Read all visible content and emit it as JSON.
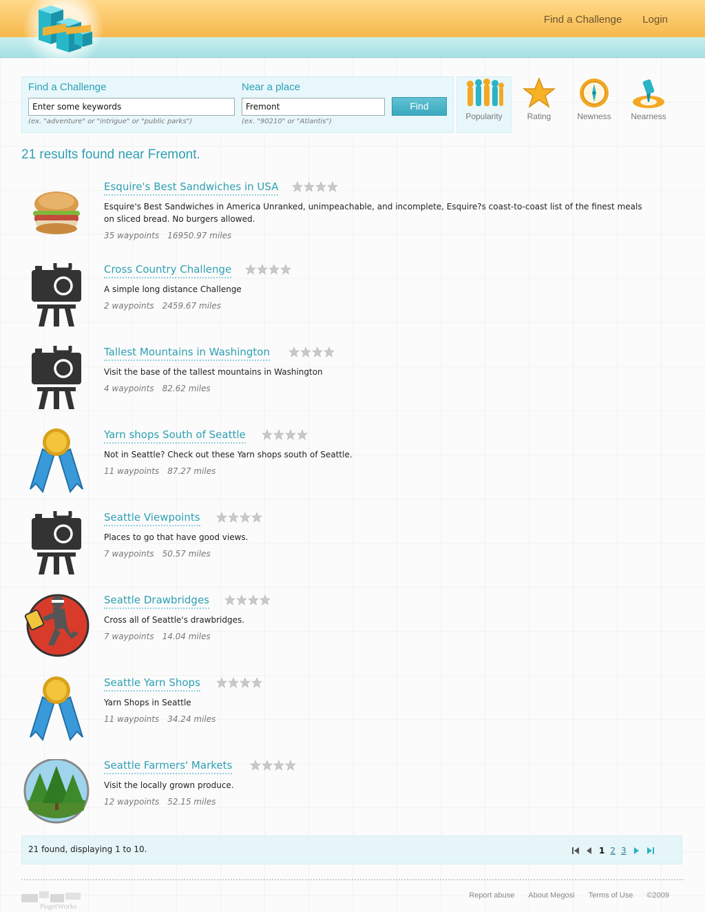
{
  "header": {
    "nav": [
      {
        "label": "Find a Challenge"
      },
      {
        "label": "Login"
      }
    ]
  },
  "search": {
    "keywords_label": "Find a Challenge",
    "keywords_value": "Enter some keywords",
    "keywords_hint": "(ex. \"adventure\" or \"intrigue\" or \"public parks\")",
    "place_label": "Near a place",
    "place_value": "Fremont",
    "place_hint": "(ex. \"90210\" or \"Atlantis\")",
    "find_label": "Find"
  },
  "sort": {
    "options": [
      {
        "label": "Popularity",
        "icon": "people-icon"
      },
      {
        "label": "Rating",
        "icon": "star-icon"
      },
      {
        "label": "Newness",
        "icon": "compass-icon"
      },
      {
        "label": "Nearness",
        "icon": "pin-icon"
      }
    ],
    "active": "Popularity"
  },
  "results_heading": "21 results found near Fremont.",
  "results": [
    {
      "title": "Esquire's Best Sandwiches in USA",
      "description": "Esquire's Best Sandwiches in America Unranked, unimpeachable, and incomplete, Esquire?s coast-to-coast list of the finest meals on sliced bread. No burgers allowed.",
      "waypoints": "35 waypoints",
      "distance": "16950.97 miles",
      "icon": "sandwich-icon",
      "rating": 0
    },
    {
      "title": "Cross Country Challenge",
      "description": "A simple long distance Challenge",
      "waypoints": "2 waypoints",
      "distance": "2459.67 miles",
      "icon": "camera-icon",
      "rating": 0
    },
    {
      "title": "Tallest Mountains in Washington",
      "description": "Visit the base of the tallest mountains in Washington",
      "waypoints": "4 waypoints",
      "distance": "82.62 miles",
      "icon": "camera-icon",
      "rating": 0
    },
    {
      "title": "Yarn shops South of Seattle",
      "description": "Not in Seattle? Check out these Yarn shops south of Seattle.",
      "waypoints": "11 waypoints",
      "distance": "87.27 miles",
      "icon": "ribbon-medal-icon",
      "rating": 0
    },
    {
      "title": "Seattle Viewpoints",
      "description": "Places to go that have good views.",
      "waypoints": "7 waypoints",
      "distance": "50.57 miles",
      "icon": "camera-icon",
      "rating": 0
    },
    {
      "title": "Seattle Drawbridges",
      "description": "Cross all of Seattle's drawbridges.",
      "waypoints": "7 waypoints",
      "distance": "14.04 miles",
      "icon": "ninja-icon",
      "rating": 0
    },
    {
      "title": "Seattle Yarn Shops",
      "description": "Yarn Shops in Seattle",
      "waypoints": "11 waypoints",
      "distance": "34.24 miles",
      "icon": "ribbon-medal-icon",
      "rating": 0
    },
    {
      "title": "Seattle Farmers' Markets",
      "description": "Visit the locally grown produce.",
      "waypoints": "12 waypoints",
      "distance": "52.15 miles",
      "icon": "trees-icon",
      "rating": 0
    }
  ],
  "pager": {
    "summary": "21 found, displaying 1 to 10.",
    "pages": [
      "1",
      "2",
      "3"
    ],
    "current": "1"
  },
  "footer": {
    "links": [
      "Report abuse",
      "About Megosi",
      "Terms of Use",
      "©2009"
    ],
    "brand": "PugetWorks"
  },
  "colors": {
    "accent": "#2d9fb3",
    "header_orange": "#f7b84a",
    "header_teal": "#a6e0e3"
  }
}
